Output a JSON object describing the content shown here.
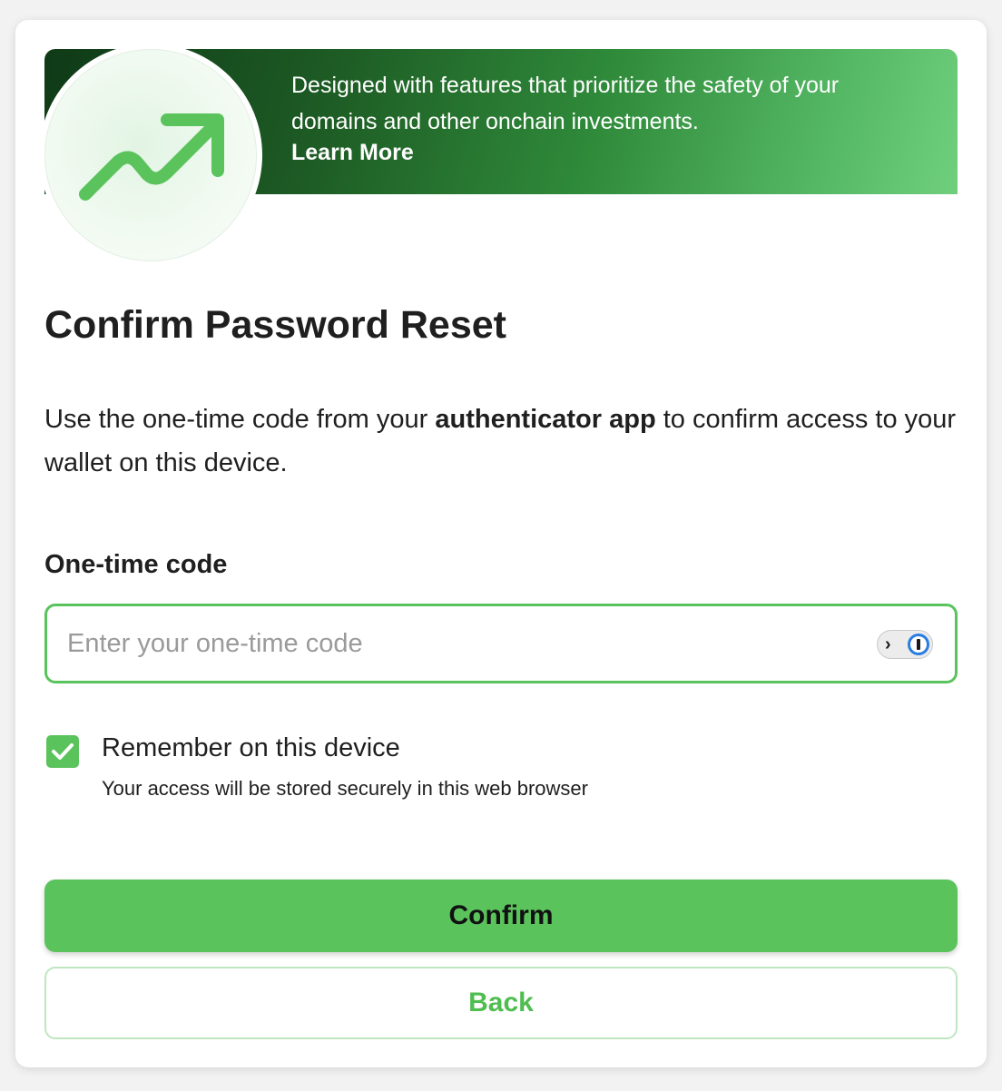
{
  "banner": {
    "text": "Designed with features that prioritize the safety of your domains and other onchain investments.",
    "link_label": "Learn More",
    "illustration": "trending-up-arrow-icon"
  },
  "page": {
    "title": "Confirm Password Reset",
    "description_prefix": "Use the one-time code from your ",
    "description_bold": "authenticator app",
    "description_suffix": " to confirm access to your wallet on this device."
  },
  "code_field": {
    "label": "One-time code",
    "placeholder": "Enter your one-time code",
    "value": "",
    "password_manager_icon": "1password-icon"
  },
  "remember": {
    "checked": true,
    "label": "Remember on this device",
    "sublabel": "Your access will be stored securely in this web browser"
  },
  "actions": {
    "confirm_label": "Confirm",
    "back_label": "Back"
  },
  "colors": {
    "accent": "#5ac35c",
    "banner_dark": "#0f3a17",
    "banner_light": "#6fcf7c"
  }
}
